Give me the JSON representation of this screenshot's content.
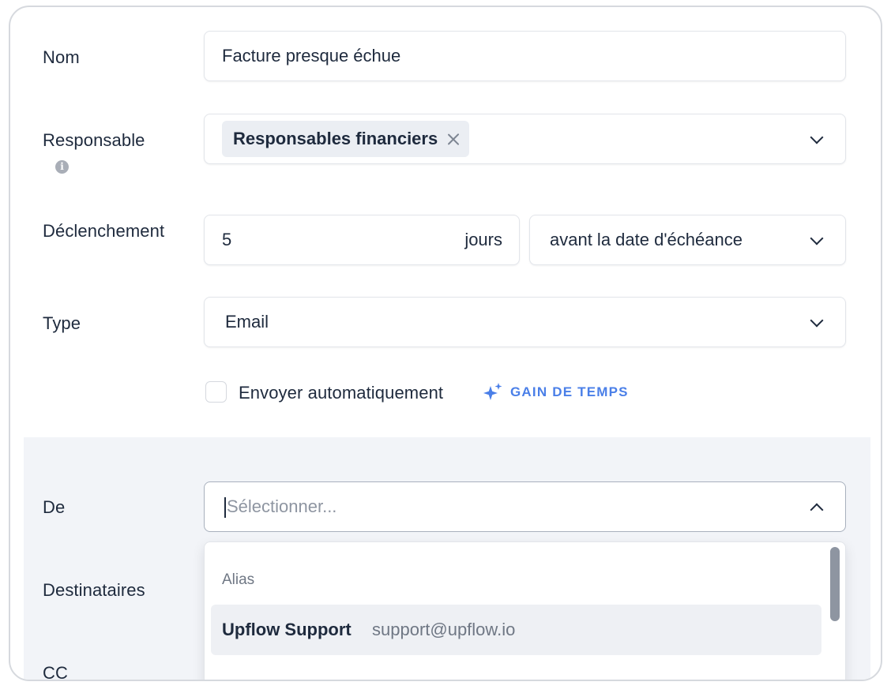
{
  "form": {
    "name_label": "Nom",
    "name_value": "Facture presque échue",
    "owner_label": "Responsable",
    "owner_tag": "Responsables financiers",
    "trigger_label": "Déclenchement",
    "trigger_days_value": "5",
    "trigger_unit": "jours",
    "trigger_relation": "avant la date d'échéance",
    "type_label": "Type",
    "type_value": "Email",
    "auto_send_label": "Envoyer automatiquement",
    "auto_send_checked": false,
    "time_saving_badge": "GAIN DE TEMPS"
  },
  "sender": {
    "from_label": "De",
    "from_placeholder": "Sélectionner...",
    "recipients_label": "Destinataires",
    "cc_label_partial": "CC",
    "dropdown": {
      "group_label": "Alias",
      "options": [
        {
          "name": "Upflow Support",
          "email": "support@upflow.io"
        }
      ]
    }
  },
  "colors": {
    "text": "#1e2a3d",
    "muted": "#6f7784",
    "accent": "#4a7fe8",
    "panel_bg": "#f2f4f8",
    "tag_bg": "#ebeef3"
  },
  "icons": {
    "info": "info-icon",
    "remove_tag": "close-icon",
    "select_chevron": "chevron-down-icon",
    "open_chevron": "chevron-up-icon",
    "sparkle": "sparkle-icon"
  }
}
